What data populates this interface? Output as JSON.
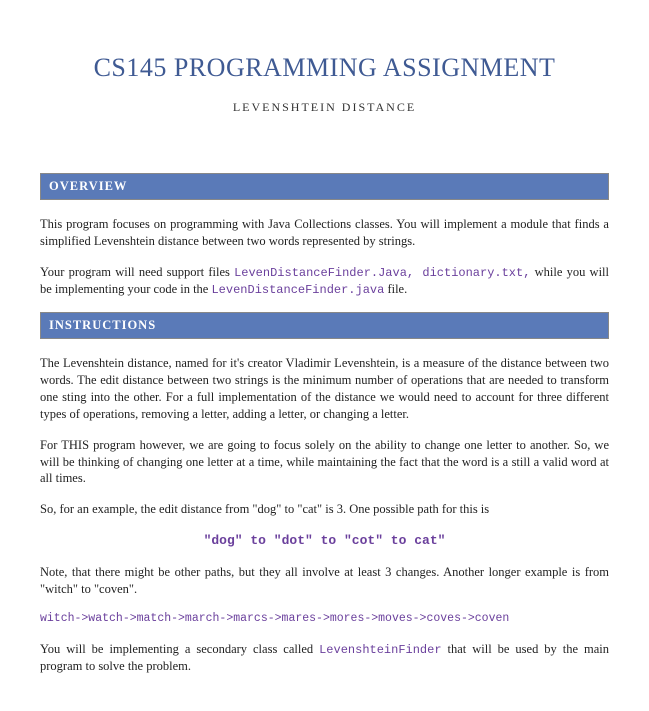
{
  "title": "CS145 PROGRAMMING ASSIGNMENT",
  "subtitle": "LEVENSHTEIN DISTANCE",
  "sections": {
    "overview": {
      "header": "OVERVIEW",
      "p1a": "This program focuses on programming with Java Collections classes. You will implement a module that finds a simplified Levenshtein distance between two words represented by strings.",
      "p2a": "Your program will need support files ",
      "p2b": "LevenDistanceFinder.Java, dictionary.txt,",
      "p2c": " while you will be implementing your code in the ",
      "p2d": "LevenDistanceFinder.java",
      "p2e": " file."
    },
    "instructions": {
      "header": "INSTRUCTIONS",
      "p1": "The Levenshtein distance, named for it's creator Vladimir Levenshtein, is a measure of the distance between two words.   The edit distance between two strings is the minimum number of operations that are needed to transform one sting into the other.  For a full implementation of the distance we would need to account for three different types of operations, removing a letter, adding a letter, or changing a letter.",
      "p2": "For THIS program however, we are going to focus solely on the ability to change one letter to another.   So, we will be thinking of changing one letter at a time, while maintaining the fact that the word is a still a valid word at all times.",
      "p3": "So, for an example, the edit distance from \"dog\" to \"cat\" is 3.   One possible path for this is",
      "example": "\"dog\" to \"dot\" to \"cot\" to cat\"",
      "p4": "Note, that there might be other paths, but they all involve at least 3 changes. Another longer example is from \"witch\" to \"coven\".",
      "chain": "witch->watch->match->march->marcs->mares->mores->moves->coves->coven",
      "p5a": "You will be implementing a secondary class called ",
      "p5b": "LevenshteinFinder",
      "p5c": " that will be used by the main program to solve the problem."
    }
  }
}
